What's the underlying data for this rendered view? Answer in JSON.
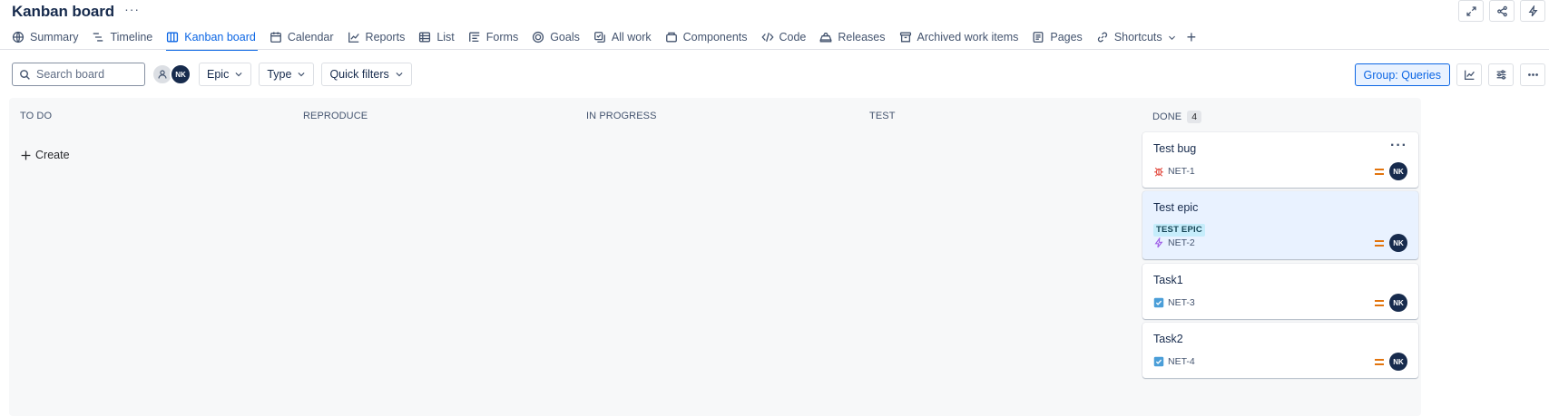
{
  "header": {
    "title": "Kanban board",
    "more_label": "···"
  },
  "tabs": [
    {
      "label": "Summary",
      "icon": "globe-icon"
    },
    {
      "label": "Timeline",
      "icon": "timeline-icon"
    },
    {
      "label": "Kanban board",
      "icon": "board-icon",
      "active": true
    },
    {
      "label": "Calendar",
      "icon": "calendar-icon"
    },
    {
      "label": "Reports",
      "icon": "chart-line-icon"
    },
    {
      "label": "List",
      "icon": "list-icon"
    },
    {
      "label": "Forms",
      "icon": "forms-icon"
    },
    {
      "label": "Goals",
      "icon": "goals-icon"
    },
    {
      "label": "All work",
      "icon": "all-work-icon"
    },
    {
      "label": "Components",
      "icon": "components-icon"
    },
    {
      "label": "Code",
      "icon": "code-icon"
    },
    {
      "label": "Releases",
      "icon": "releases-icon"
    },
    {
      "label": "Archived work items",
      "icon": "archive-icon"
    },
    {
      "label": "Pages",
      "icon": "pages-icon"
    },
    {
      "label": "Shortcuts",
      "icon": "link-icon"
    }
  ],
  "toolbar": {
    "search_placeholder": "Search board",
    "avatar_initials": "NK",
    "epic_label": "Epic",
    "type_label": "Type",
    "quick_filters_label": "Quick filters",
    "group_label": "Group: Queries"
  },
  "columns": {
    "todo": {
      "name": "TO DO",
      "create_label": "Create"
    },
    "reproduce": {
      "name": "REPRODUCE"
    },
    "inprogress": {
      "name": "IN PROGRESS"
    },
    "test": {
      "name": "TEST"
    },
    "done": {
      "name": "DONE",
      "count": "4",
      "cards": [
        {
          "title": "Test bug",
          "key": "NET-1",
          "type": "bug",
          "assignee": "NK"
        },
        {
          "title": "Test epic",
          "key": "NET-2",
          "type": "epic",
          "badge": "TEST EPIC",
          "assignee": "NK"
        },
        {
          "title": "Task1",
          "key": "NET-3",
          "type": "task",
          "assignee": "NK"
        },
        {
          "title": "Task2",
          "key": "NET-4",
          "type": "task",
          "assignee": "NK"
        }
      ]
    }
  },
  "colors": {
    "accent": "#0c66e4",
    "priority_medium": "#e2740d",
    "bug": "#e2483d",
    "epic": "#9f5fe8",
    "task": "#4a9ed8"
  }
}
